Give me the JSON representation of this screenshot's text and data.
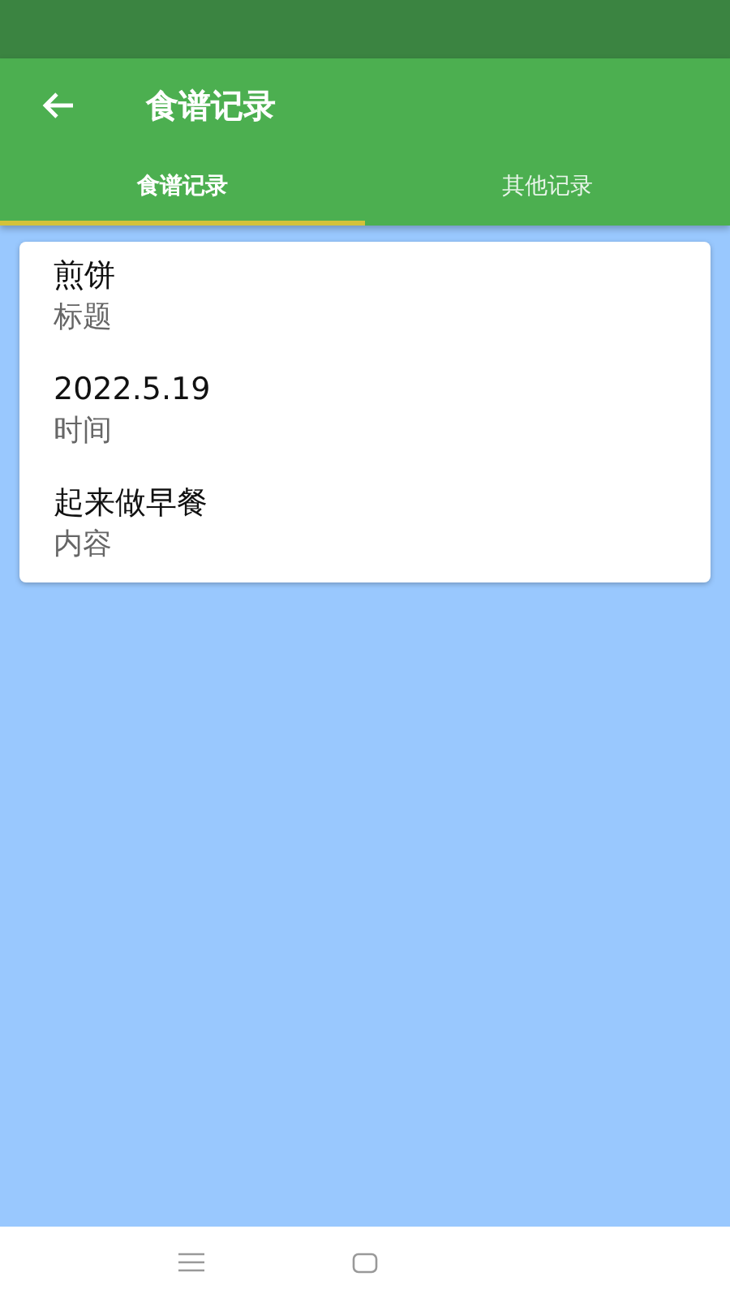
{
  "app_bar": {
    "title": "食谱记录"
  },
  "tabs": [
    {
      "label": "食谱记录",
      "selected": true
    },
    {
      "label": "其他记录",
      "selected": false
    }
  ],
  "record": {
    "fields": [
      {
        "value": "煎饼",
        "label": "标题"
      },
      {
        "value": "2022.5.19",
        "label": "时间"
      },
      {
        "value": "起来做早餐",
        "label": "内容"
      }
    ]
  }
}
